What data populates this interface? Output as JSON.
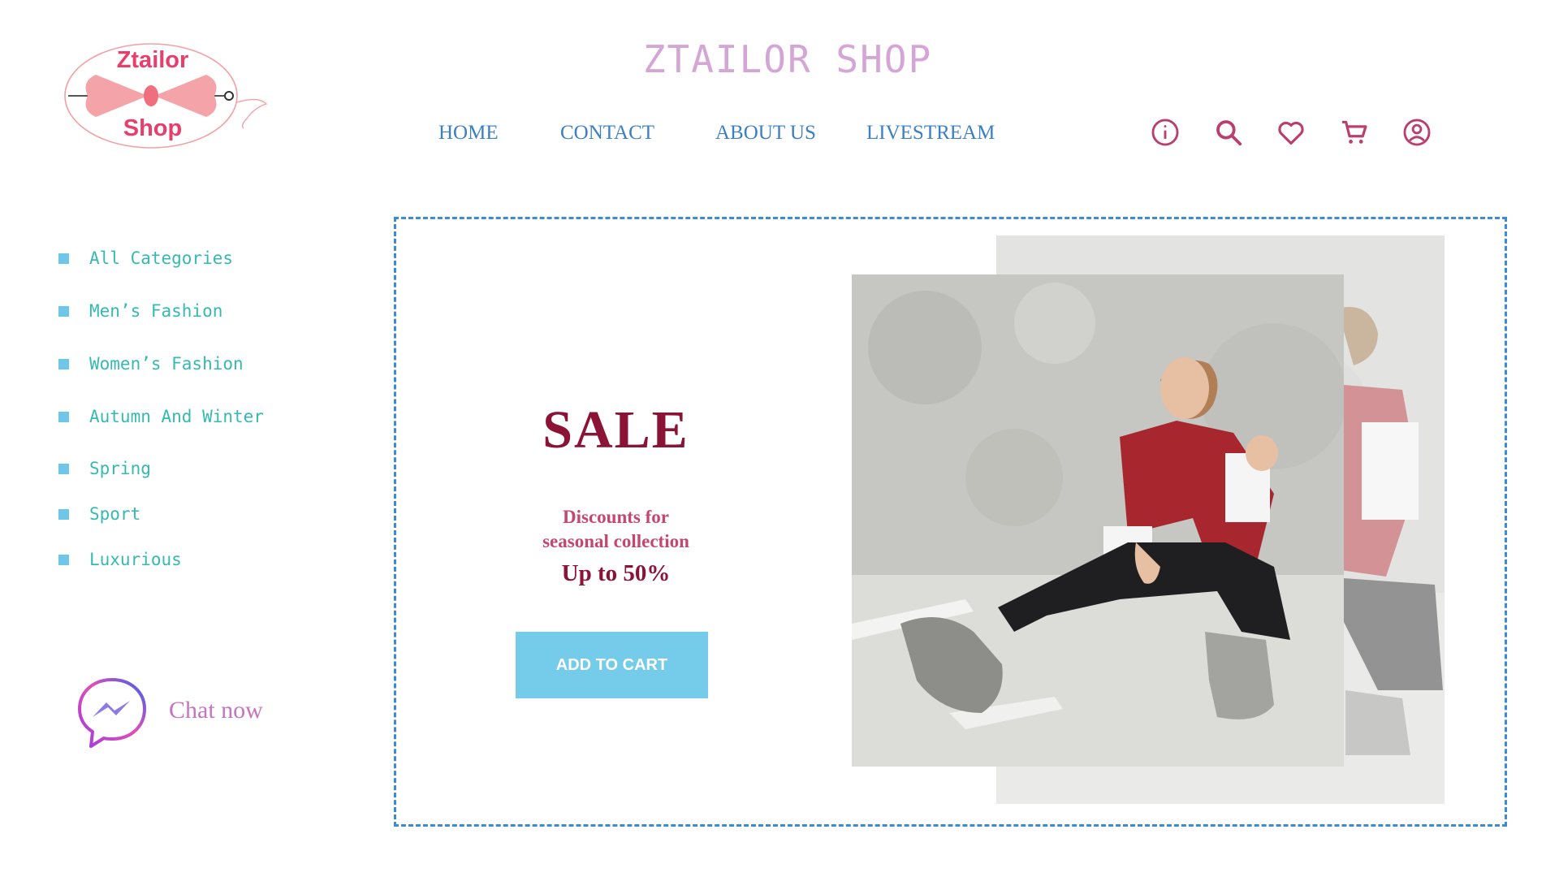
{
  "logo": {
    "line1": "Ztailor",
    "line2": "Shop",
    "brand_color": "#e83e6c",
    "bow_color": "#f4a3a8"
  },
  "site_title": "ZTAILOR SHOP",
  "nav": [
    {
      "label": "HOME"
    },
    {
      "label": "CONTACT"
    },
    {
      "label": "ABOUT US"
    },
    {
      "label": "LIVESTREAM"
    }
  ],
  "header_icons": [
    "info-icon",
    "search-icon",
    "heart-icon",
    "cart-icon",
    "user-icon"
  ],
  "icon_color": "#b83f6e",
  "categories": [
    {
      "label": "All Categories"
    },
    {
      "label": "Men’s Fashion"
    },
    {
      "label": "Women’s Fashion"
    },
    {
      "label": "Autumn And Winter"
    },
    {
      "label": "Spring"
    },
    {
      "label": "Sport"
    },
    {
      "label": "Luxurious"
    }
  ],
  "chat": {
    "label": "Chat now",
    "icon": "messenger-icon"
  },
  "banner": {
    "title": "SALE",
    "subtitle_line1": "Discounts for",
    "subtitle_line2": "seasonal collection",
    "discount": "Up to 50%",
    "button_label": "ADD TO CART"
  },
  "colors": {
    "accent_blue": "#3d8bd0",
    "button": "#74cbea",
    "sale_text": "#8b1336",
    "subtitle_text": "#c4476f",
    "category_text": "#36b9b3",
    "bullet": "#6ec6e8",
    "title_text": "#d4a6d6"
  }
}
